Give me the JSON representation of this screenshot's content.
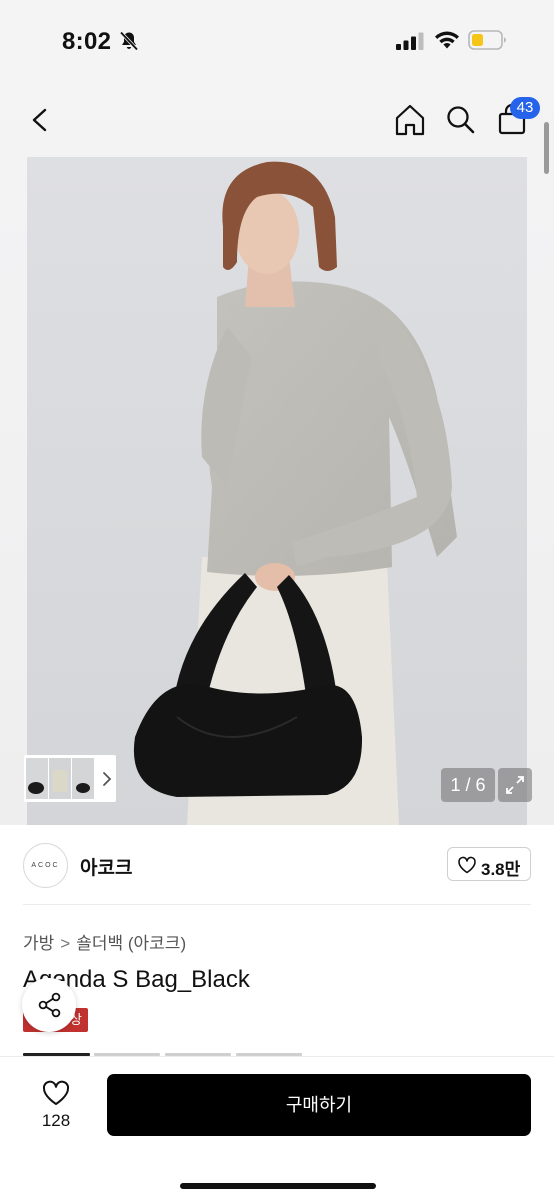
{
  "status_bar": {
    "time": "8:02",
    "icons": [
      "bell-slash-icon",
      "cellular-signal-icon",
      "wifi-icon",
      "battery-low-icon"
    ],
    "battery_color": "#f5c518"
  },
  "nav": {
    "icons": [
      "chevron-left-icon",
      "home-icon",
      "search-icon",
      "shopping-bag-icon"
    ],
    "cart_count": "43",
    "badge_color": "#2563eb"
  },
  "gallery": {
    "page_counter": "1 / 6",
    "icons": [
      "thumbnail-strip",
      "chevron-right-icon",
      "expand-icon"
    ]
  },
  "brand": {
    "logo_text": "ACOC",
    "name": "아코크",
    "likes": "3.8만"
  },
  "breadcrumb": {
    "category": "가방",
    "separator": ">",
    "subcategory": "숄더백 (아코크)"
  },
  "product": {
    "title": "Agenda S Bag_Black",
    "tag_text": "상",
    "tag_color": "#c0312f"
  },
  "bottom_bar": {
    "wish_count": "128",
    "buy_label": "구매하기"
  }
}
